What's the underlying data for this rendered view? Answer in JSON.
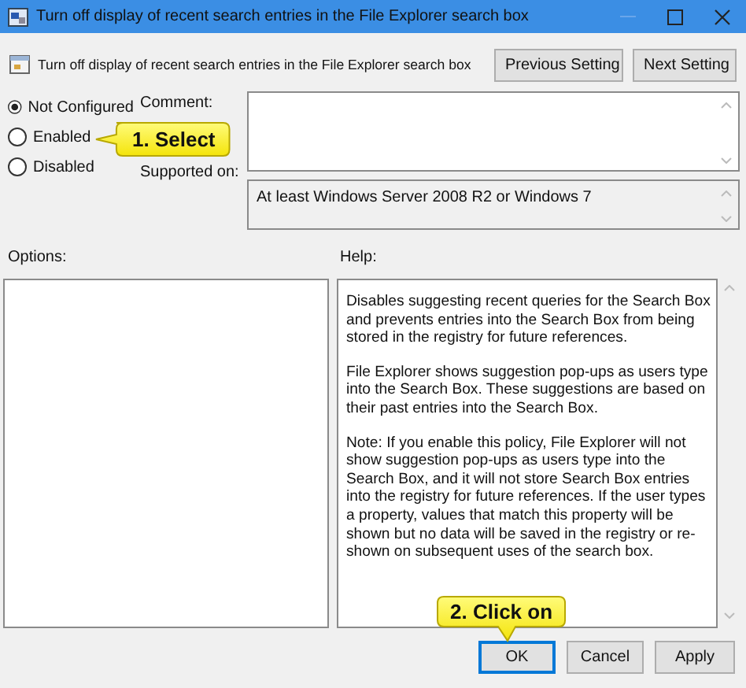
{
  "window": {
    "title": "Turn off display of recent search entries in the File Explorer search box"
  },
  "header": {
    "policy_name": "Turn off display of recent search entries in the File Explorer search box",
    "buttons": [
      {
        "label": "Previous Setting"
      },
      {
        "label": "Next Setting"
      }
    ]
  },
  "state_options": [
    {
      "label": "Not Configured",
      "selected": true
    },
    {
      "label": "Enabled",
      "selected": false
    },
    {
      "label": "Disabled",
      "selected": false
    }
  ],
  "comment": {
    "label": "Comment:"
  },
  "supported_on": {
    "label": "Supported on:",
    "value": "At least Windows Server 2008 R2 or Windows 7"
  },
  "options": {
    "label": "Options:"
  },
  "help": {
    "label": "Help:",
    "paragraphs": [
      "Disables suggesting recent queries for the Search Box and prevents entries into the Search Box from being stored in the registry for future references.",
      "File Explorer shows suggestion pop-ups as users type into the Search Box.  These suggestions are based on their past entries into the Search Box.",
      "Note: If you enable this policy, File Explorer will not show suggestion pop-ups as users type into the Search Box, and it will not store Search Box entries into the registry for future references.  If the user types a property, values that match this property will be shown but no data will be saved in the registry or re-shown on subsequent uses of the search box."
    ]
  },
  "buttons": [
    {
      "label": "OK",
      "focused": true
    },
    {
      "label": "Cancel",
      "focused": false
    },
    {
      "label": "Apply",
      "focused": false
    }
  ],
  "callouts": [
    {
      "text": "1. Select",
      "kind": "left"
    },
    {
      "text": "2. Click on",
      "kind": "down"
    }
  ]
}
